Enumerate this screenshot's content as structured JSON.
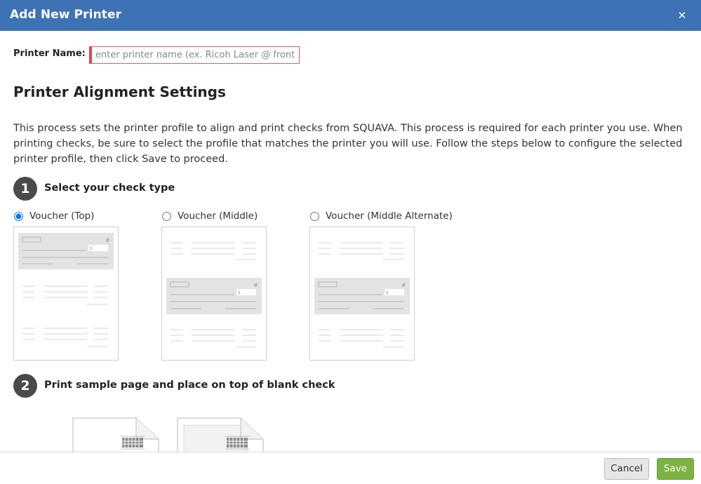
{
  "dialog": {
    "title": "Add New Printer",
    "close_icon": "close-icon"
  },
  "printer_name": {
    "label": "Printer Name:",
    "value": "",
    "placeholder": "enter printer name (ex. Ricoh Laser @ front desk)"
  },
  "section_title": "Printer Alignment Settings",
  "description": "This process sets the printer profile to align and print checks from SQUAVA. This process is required for each printer you use. When printing checks, be sure to select the profile that matches the printer you will use. Follow the steps below to configure the selected printer profile, then click Save to proceed.",
  "steps": [
    {
      "number": "1",
      "title": "Select your check type"
    },
    {
      "number": "2",
      "title": "Print sample page and place on top of blank check"
    }
  ],
  "check_types": [
    {
      "label": "Voucher (Top)",
      "selected": true
    },
    {
      "label": "Voucher (Middle)",
      "selected": false
    },
    {
      "label": "Voucher (Middle Alternate)",
      "selected": false
    }
  ],
  "footer": {
    "cancel_label": "Cancel",
    "save_label": "Save"
  },
  "colors": {
    "header": "#3d72b4",
    "save": "#7cb342",
    "input_error": "#e0454d",
    "step_badge": "#4a4a4a"
  }
}
